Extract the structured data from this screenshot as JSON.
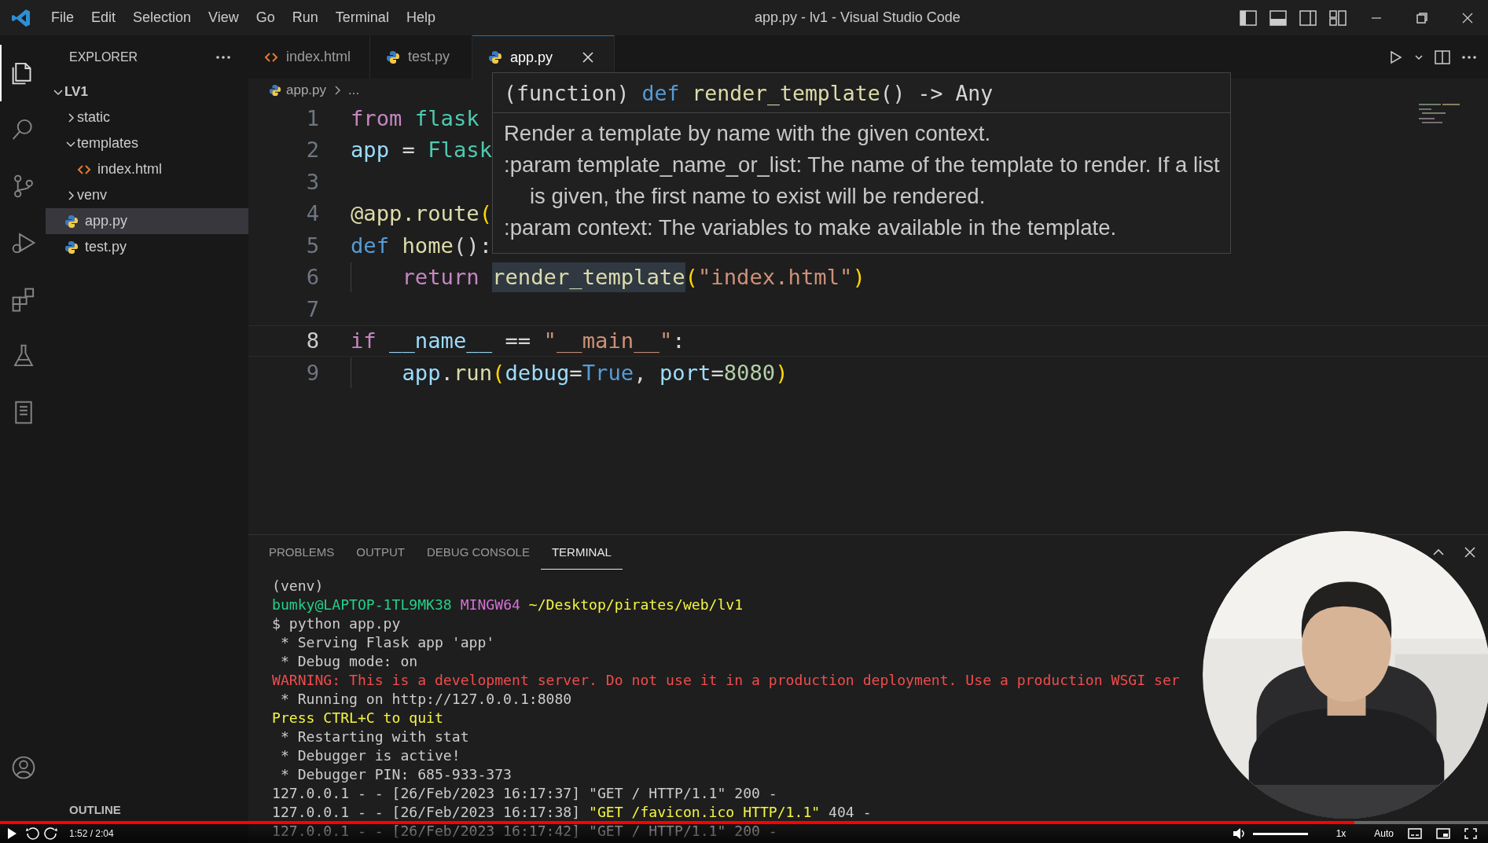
{
  "title_bar": {
    "menu": [
      "File",
      "Edit",
      "Selection",
      "View",
      "Go",
      "Run",
      "Terminal",
      "Help"
    ],
    "title": "app.py - lv1 - Visual Studio Code"
  },
  "activity_bar": {
    "items": [
      {
        "kind": "files",
        "selected": true
      },
      {
        "kind": "search",
        "selected": false
      },
      {
        "kind": "source-control",
        "selected": false
      },
      {
        "kind": "run-debug",
        "selected": false
      },
      {
        "kind": "extensions",
        "selected": false
      },
      {
        "kind": "testing",
        "selected": false
      },
      {
        "kind": "notebook",
        "selected": false
      }
    ],
    "bottom": [
      {
        "kind": "account"
      }
    ]
  },
  "sidebar": {
    "title": "EXPLORER",
    "root": {
      "label": "LV1",
      "expanded": true
    },
    "tree": [
      {
        "label": "static",
        "kind": "folder",
        "expanded": false,
        "selected": false
      },
      {
        "label": "templates",
        "kind": "folder",
        "expanded": true,
        "selected": false,
        "children": [
          {
            "label": "index.html",
            "kind": "html",
            "selected": false
          }
        ]
      },
      {
        "label": "venv",
        "kind": "folder",
        "expanded": false,
        "selected": false
      },
      {
        "label": "app.py",
        "kind": "python",
        "selected": true
      },
      {
        "label": "test.py",
        "kind": "python",
        "selected": false
      }
    ],
    "outline": "OUTLINE"
  },
  "tabs": [
    {
      "label": "index.html",
      "kind": "html",
      "selected": false
    },
    {
      "label": "test.py",
      "kind": "python",
      "selected": false
    },
    {
      "label": "app.py",
      "kind": "python",
      "selected": true
    }
  ],
  "breadcrumb": [
    "app.py",
    "..."
  ],
  "editor": {
    "lines": [
      {
        "number": "1",
        "current": false,
        "tokens": [
          {
            "kind": "keyword",
            "text": "from"
          },
          {
            "kind": "module",
            "text": " flask"
          }
        ]
      },
      {
        "number": "2",
        "current": false,
        "tokens": [
          {
            "kind": "var",
            "text": "app"
          },
          {
            "kind": "plain",
            "text": " = "
          },
          {
            "kind": "module",
            "text": "Flask"
          }
        ]
      },
      {
        "number": "3",
        "current": false
      },
      {
        "number": "4",
        "current": false,
        "tokens": [
          {
            "kind": "fn",
            "text": "@app.route"
          },
          {
            "kind": "paren",
            "text": "("
          }
        ]
      },
      {
        "number": "5",
        "current": false,
        "tokens": [
          {
            "kind": "storage",
            "text": "def"
          },
          {
            "kind": "fn",
            "text": " home"
          },
          {
            "kind": "plain",
            "text": "():"
          }
        ]
      },
      {
        "number": "6",
        "current": false,
        "tokens": [
          {
            "kind": "keyword",
            "text": "    return "
          },
          {
            "kind": "hover",
            "text": "render_template"
          },
          {
            "kind": "paren",
            "text": "("
          },
          {
            "kind": "string",
            "text": "\"index.html\""
          },
          {
            "kind": "paren",
            "text": ")"
          }
        ]
      },
      {
        "number": "7",
        "current": false
      },
      {
        "number": "8",
        "current": true,
        "tokens": [
          {
            "kind": "keyword",
            "text": "if"
          },
          {
            "kind": "var",
            "text": " __name__"
          },
          {
            "kind": "plain",
            "text": " == "
          },
          {
            "kind": "string",
            "text": "\"__main__\""
          },
          {
            "kind": "plain",
            "text": ":"
          }
        ]
      },
      {
        "number": "9",
        "current": false,
        "tokens": [
          {
            "kind": "var",
            "text": "    app"
          },
          {
            "kind": "plain",
            "text": "."
          },
          {
            "kind": "fn",
            "text": "run"
          },
          {
            "kind": "paren",
            "text": "("
          },
          {
            "kind": "var",
            "text": "debug"
          },
          {
            "kind": "plain",
            "text": "="
          },
          {
            "kind": "storage",
            "text": "True"
          },
          {
            "kind": "plain",
            "text": ", "
          },
          {
            "kind": "var",
            "text": "port"
          },
          {
            "kind": "plain",
            "text": "="
          },
          {
            "kind": "number",
            "text": "8080"
          },
          {
            "kind": "paren",
            "text": ")"
          }
        ]
      }
    ]
  },
  "hover": {
    "signature": [
      {
        "kind": "plain",
        "text": "(function) "
      },
      {
        "kind": "storage",
        "text": "def"
      },
      {
        "kind": "fn",
        "text": " render_template"
      },
      {
        "kind": "plain",
        "text": "() -> Any"
      }
    ],
    "paragraphs": [
      "Render a template by name with the given context.",
      ":param template_name_or_list: The name of the template to render. If a list is given, the first name to exist will be rendered.",
      ":param context: The variables to make available in the template."
    ]
  },
  "panel": {
    "tabs": [
      {
        "label": "PROBLEMS",
        "selected": false
      },
      {
        "label": "OUTPUT",
        "selected": false
      },
      {
        "label": "DEBUG CONSOLE",
        "selected": false
      },
      {
        "label": "TERMINAL",
        "selected": true
      }
    ],
    "terminal_lines": [
      [
        {
          "kind": "plain",
          "text": "(venv)"
        }
      ],
      [
        {
          "kind": "user",
          "text": "bumky@LAPTOP-1TL9MK38"
        },
        {
          "kind": "host",
          "text": " MINGW64"
        },
        {
          "kind": "path",
          "text": " ~/Desktop/pirates/web/lv1"
        }
      ],
      [
        {
          "kind": "plain",
          "text": "$ python app.py"
        }
      ],
      [
        {
          "kind": "plain",
          "text": " * Serving Flask app 'app'"
        }
      ],
      [
        {
          "kind": "plain",
          "text": " * Debug mode: on"
        }
      ],
      [
        {
          "kind": "warning",
          "text": "WARNING: This is a development server. Do not use it in a production deployment. Use a production WSGI ser"
        }
      ],
      [
        {
          "kind": "plain",
          "text": " * Running on http://127.0.0.1:8080"
        }
      ],
      [
        {
          "kind": "notice",
          "text": "Press CTRL+C to quit"
        }
      ],
      [
        {
          "kind": "plain",
          "text": " * Restarting with stat"
        }
      ],
      [
        {
          "kind": "plain",
          "text": " * Debugger is active!"
        }
      ],
      [
        {
          "kind": "plain",
          "text": " * Debugger PIN: 685-933-373"
        }
      ],
      [
        {
          "kind": "plain",
          "text": "127.0.0.1 - - [26/Feb/2023 16:17:37] \"GET / HTTP/1.1\" 200 -"
        }
      ],
      [
        {
          "kind": "plain",
          "text": "127.0.0.1 - - [26/Feb/2023 16:17:38] "
        },
        {
          "kind": "notice",
          "text": "\"GET /favicon.ico HTTP/1.1\""
        },
        {
          "kind": "plain",
          "text": " 404 -"
        }
      ],
      [
        {
          "kind": "plain",
          "text": "127.0.0.1 - - [26/Feb/2023 16:17:42] \"GET / HTTP/1.1\" 200 -"
        }
      ]
    ]
  },
  "webcam": {
    "kind": "picture"
  },
  "video": {
    "progress": {
      "level": 0.91
    },
    "time": "1:52 / 2:04",
    "volume": {
      "level": 1
    },
    "speed": "1x",
    "quality": "Auto"
  }
}
